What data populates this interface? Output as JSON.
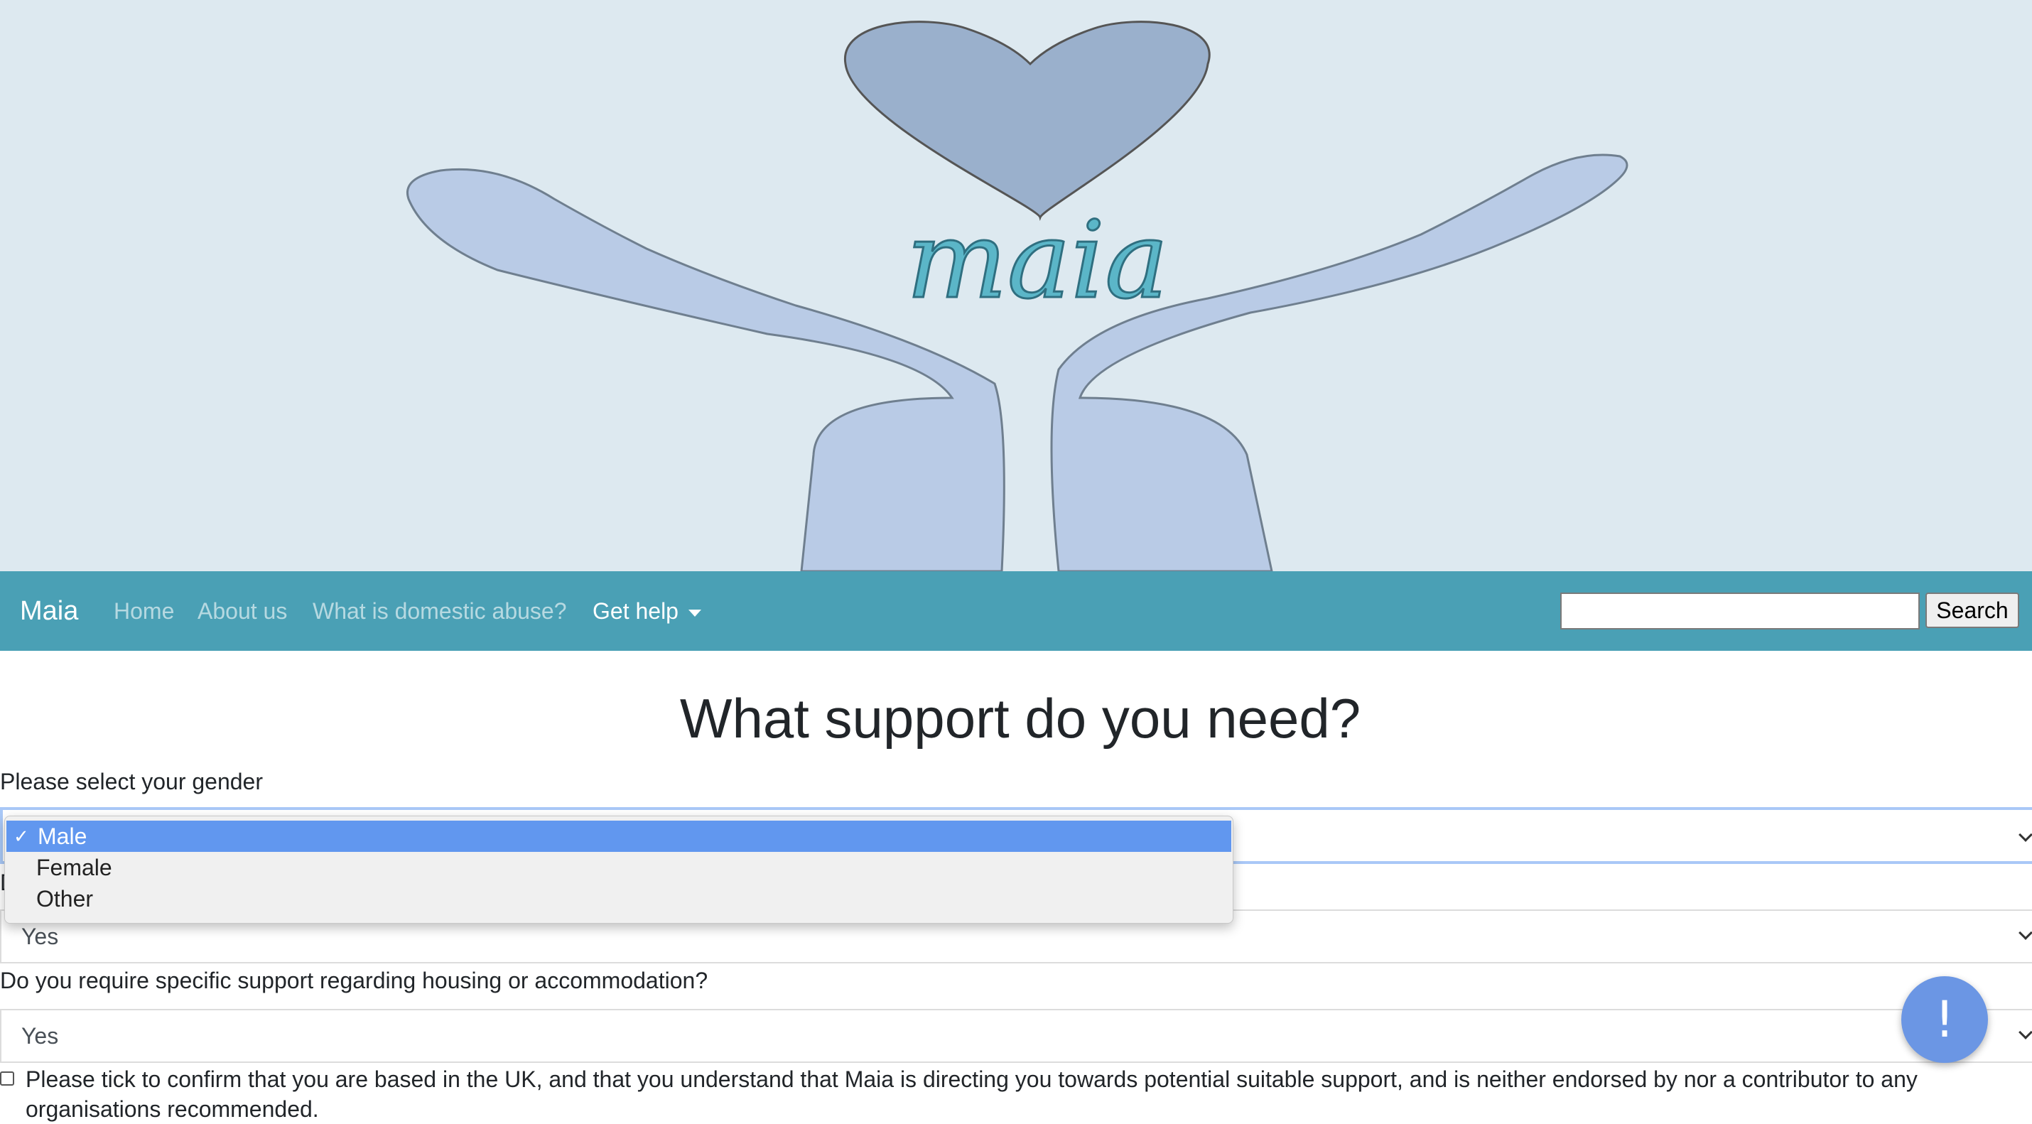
{
  "hero": {
    "logo_text": "maia",
    "colors": {
      "background": "#dde9f0",
      "heart": "#9ab0cc",
      "hands": "#b9cbe6",
      "logo": "#5bb6c8"
    }
  },
  "navbar": {
    "brand": "Maia",
    "links": [
      {
        "label": "Home"
      },
      {
        "label": "About us"
      },
      {
        "label": "What is domestic abuse?"
      },
      {
        "label": "Get help"
      }
    ],
    "search_value": "",
    "search_button": "Search",
    "color": "#4aa0b5"
  },
  "main": {
    "title": "What support do you need?",
    "gender": {
      "label": "Please select your gender",
      "options": [
        "Male",
        "Female",
        "Other"
      ],
      "selected": "Male"
    },
    "hidden_question": {
      "label_initial": "D",
      "value": "Yes"
    },
    "housing": {
      "label": "Do you require specific support regarding housing or accommodation?",
      "value": "Yes"
    },
    "confirm": {
      "text": "Please tick to confirm that you are based in the UK, and that you understand that Maia is directing you towards potential suitable support, and is neither endorsed by nor a contributor to any organisations recommended.",
      "checked": false
    }
  },
  "fab": {
    "symbol": "!",
    "icon": "exclamation-icon",
    "color": "#6b96e4"
  }
}
